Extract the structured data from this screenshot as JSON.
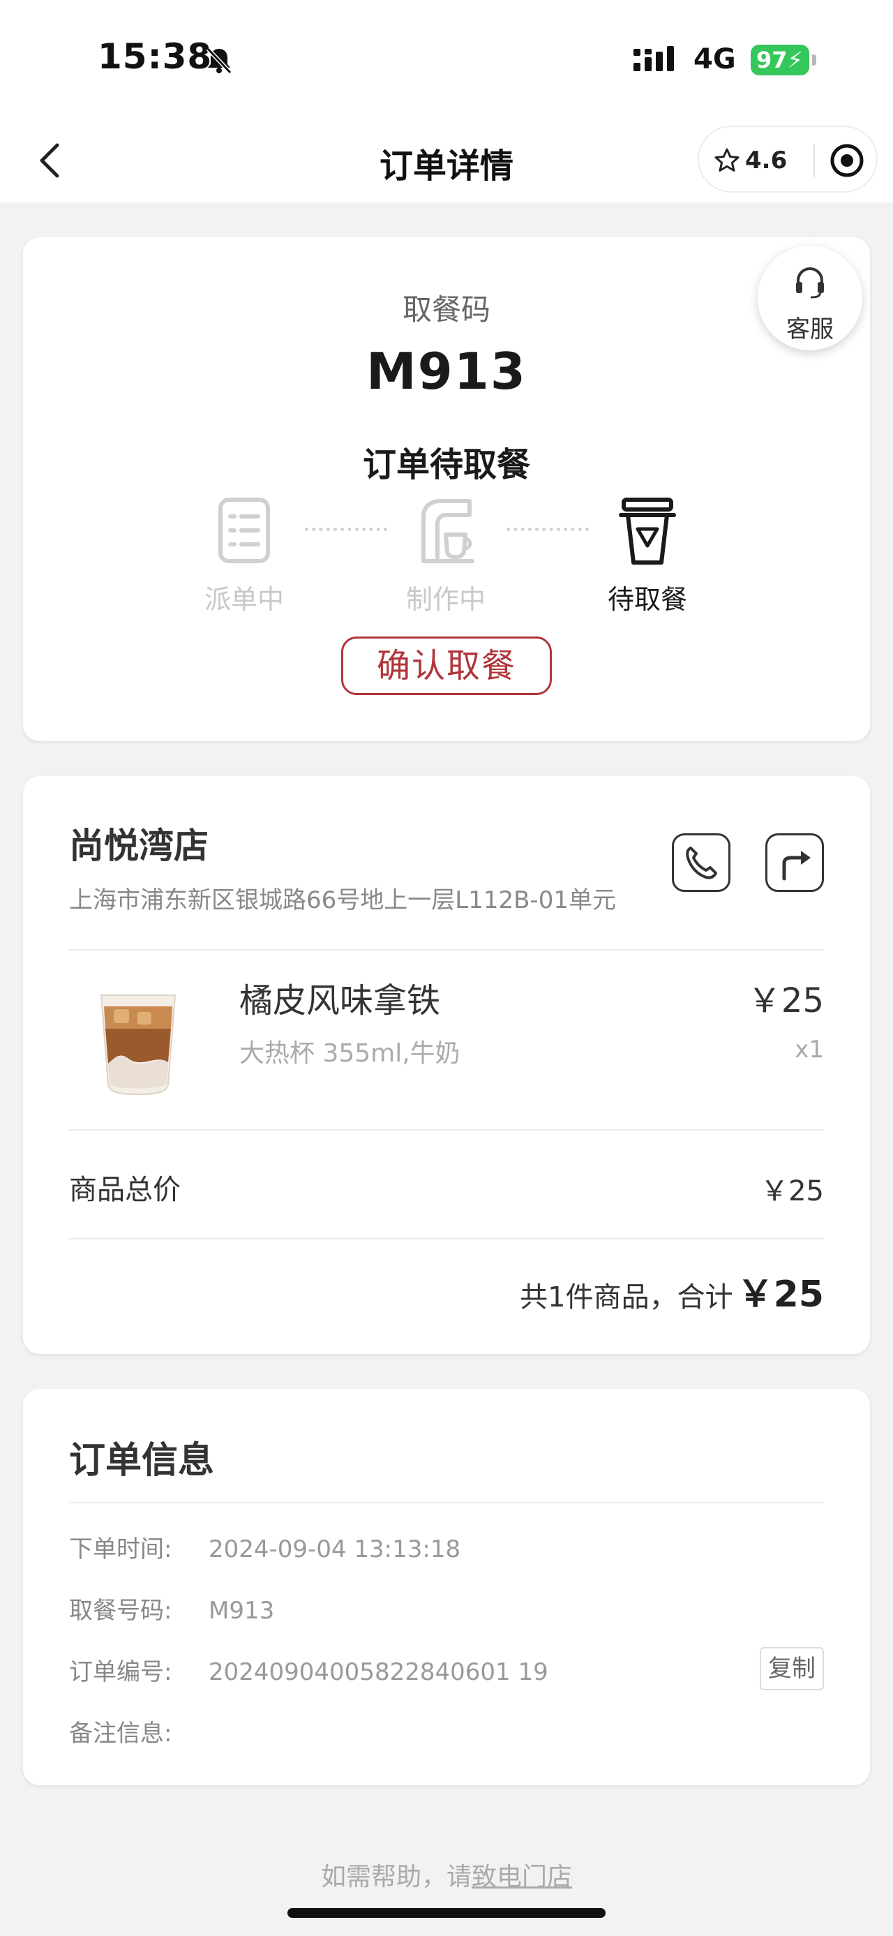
{
  "status_bar": {
    "time": "15:38",
    "network": "4G",
    "battery": "97"
  },
  "nav": {
    "title": "订单详情",
    "rating": "4.6"
  },
  "order_status": {
    "pickup_label": "取餐码",
    "pickup_code": "M913",
    "status_text": "订单待取餐",
    "service_label": "客服",
    "steps": [
      {
        "label": "派单中",
        "active": false
      },
      {
        "label": "制作中",
        "active": false
      },
      {
        "label": "待取餐",
        "active": true
      }
    ],
    "confirm_button": "确认取餐"
  },
  "store": {
    "name": "尚悦湾店",
    "address": "上海市浦东新区银城路66号地上一层L112B-01单元"
  },
  "product": {
    "name": "橘皮风味拿铁",
    "spec": "大热杯 355ml,牛奶",
    "price": "￥25",
    "quantity": "x1"
  },
  "summary": {
    "subtotal_label": "商品总价",
    "subtotal_value": "￥25",
    "total_prefix": "共1件商品，合计",
    "total_amount": "￥25"
  },
  "order_info": {
    "title": "订单信息",
    "rows": [
      {
        "label": "下单时间:",
        "value": "2024-09-04 13:13:18"
      },
      {
        "label": "取餐号码:",
        "value": "M913"
      },
      {
        "label": "订单编号:",
        "value": "20240904005822840601 19"
      },
      {
        "label": "备注信息:",
        "value": ""
      }
    ],
    "copy_button": "复制"
  },
  "footer": {
    "help_text": "如需帮助，请",
    "help_link": "致电门店"
  },
  "colors": {
    "accent": "#b0353b",
    "battery": "#34c759",
    "background": "#f2f2f2"
  }
}
